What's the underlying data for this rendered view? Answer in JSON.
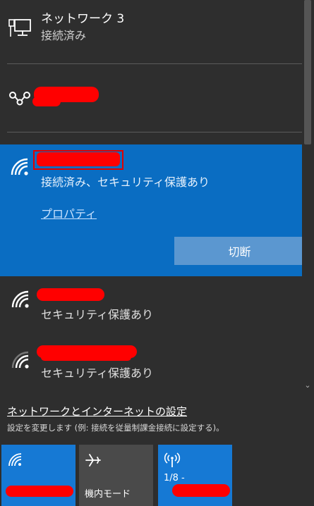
{
  "networks": [
    {
      "title": "ネットワーク 3",
      "status": "接続済み"
    },
    {
      "status": "接続済み、セキュリティ保護あり",
      "properties_label": "プロパティ",
      "disconnect_label": "切断"
    },
    {
      "status": "セキュリティ保護あり"
    },
    {
      "status": "セキュリティ保護あり"
    }
  ],
  "settings": {
    "link": "ネットワークとインターネットの設定",
    "description": "設定を変更します (例: 接続を従量制課金接続に設定する)。"
  },
  "tiles": {
    "airplane_label": "機内モード",
    "hotspot_label": "1/8 -"
  },
  "icons": [
    "ethernet-icon",
    "dialup-icon",
    "wifi-icon",
    "airplane-icon",
    "hotspot-icon",
    "chevron-down-icon"
  ],
  "colors": {
    "accent": "#0a6dc2",
    "tile_active": "#1679d4",
    "tile_inactive": "#4a4a4a",
    "background": "#2e2e2e",
    "redaction": "#ff0000"
  }
}
